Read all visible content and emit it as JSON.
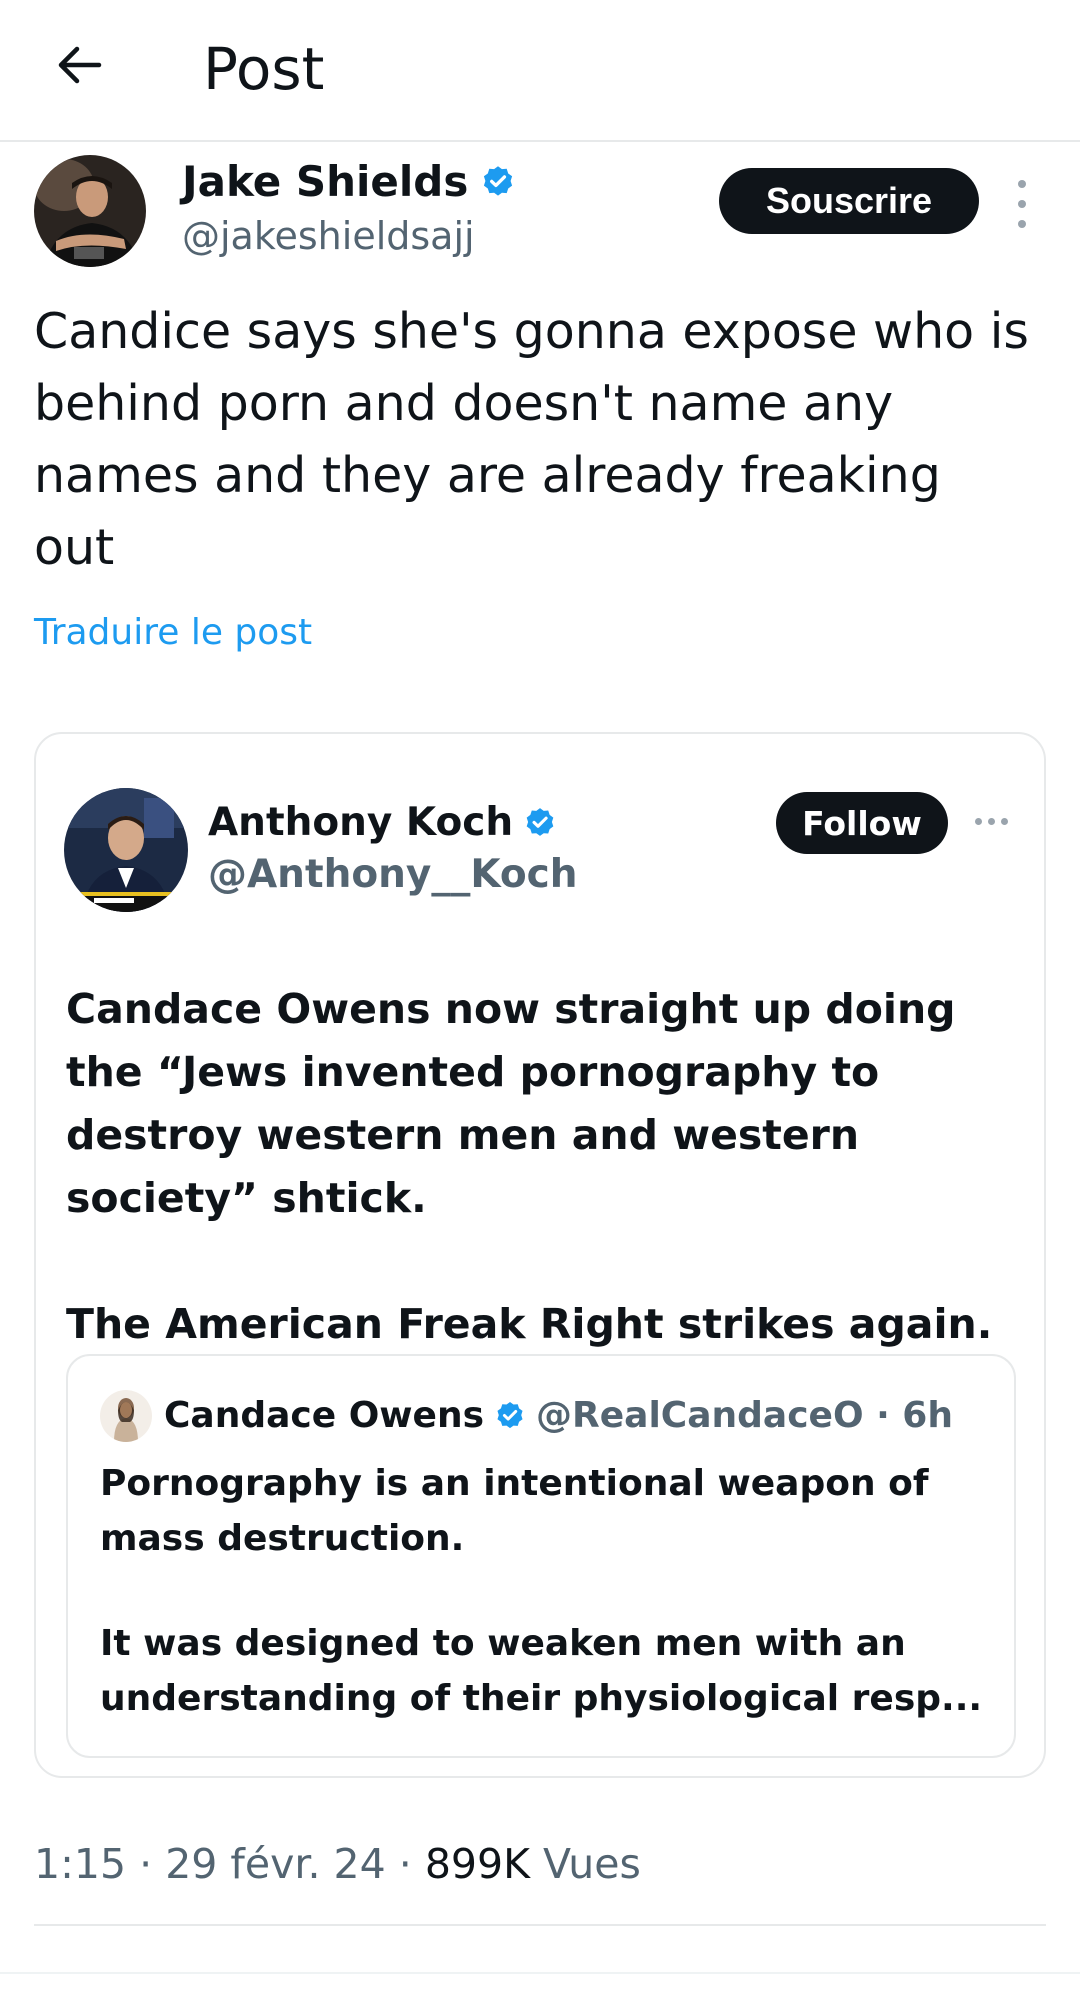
{
  "header": {
    "title": "Post",
    "back_icon": "arrow-left-icon"
  },
  "post": {
    "author": {
      "name": "Jake Shields",
      "handle": "@jakeshieldsajj",
      "verified": true
    },
    "subscribe_label": "Souscrire",
    "text": "Candice says she's gonna expose who is behind porn and doesn't name any names and they are already freaking out",
    "translate_label": "Traduire le post"
  },
  "quote": {
    "author": {
      "name": "Anthony Koch",
      "handle": "@Anthony__Koch",
      "verified": true
    },
    "follow_label": "Follow",
    "paragraphs": [
      "Candace Owens now straight up doing the “Jews invented pornography to destroy western men and western society” shtick.",
      "The American Freak Right strikes again."
    ],
    "nested": {
      "author": {
        "name": "Candace Owens",
        "handle": "@RealCandaceO",
        "verified": true
      },
      "meta": "@RealCandaceO · 6h",
      "paragraphs": [
        "Pornography is an intentional weapon of mass destruction.",
        "It was designed to weaken men with an understanding of their physiological resp..."
      ]
    }
  },
  "footer": {
    "time": "1:15",
    "date": "29 févr. 24",
    "views_count": "899K",
    "views_label": "Vues"
  },
  "colors": {
    "accent": "#1d9bf0",
    "text": "#0f1419",
    "muted": "#536471",
    "border": "#e7e9ea"
  }
}
